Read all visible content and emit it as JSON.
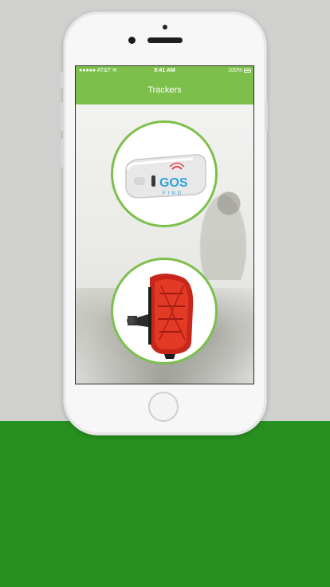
{
  "statusbar": {
    "carrier": "AT&T",
    "time": "9:41 AM",
    "battery": "100%"
  },
  "navbar": {
    "title": "Trackers"
  },
  "trackers": [
    {
      "name": "collar-gps-tracker",
      "logo": "GOS"
    },
    {
      "name": "red-gps-tracker"
    }
  ],
  "colors": {
    "accent": "#7cc04b",
    "bottom_band": "#27901f",
    "tracker_red": "#d8341f"
  }
}
